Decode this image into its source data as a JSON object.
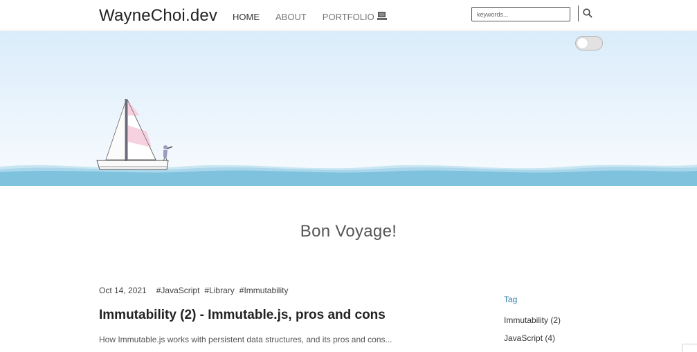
{
  "header": {
    "logo": "WayneChoi.dev",
    "nav": [
      {
        "label": "HOME",
        "active": true
      },
      {
        "label": "ABOUT",
        "active": false
      },
      {
        "label": "PORTFOLIO",
        "active": false
      }
    ],
    "nav_icon": "computer-icon",
    "search": {
      "placeholder": "keywords...",
      "value": ""
    },
    "search_icon": "search-icon"
  },
  "hero": {
    "theme_toggle": {
      "state": "off"
    },
    "colors": {
      "sky_top": "#daecfa",
      "sea": "#7ec2de",
      "sail_pink": "#f6d2e0"
    }
  },
  "page_title": "Bon Voyage!",
  "post": {
    "date": "Oct 14, 2021",
    "tags": [
      "#JavaScript",
      "#Library",
      "#Immutability"
    ],
    "title": "Immutability (2) - Immutable.js, pros and cons",
    "description": "How Immutable.js works with persistent data structures, and its pros and cons..."
  },
  "sidebar": {
    "heading": "Tag",
    "items": [
      {
        "label": "Immutability (2)"
      },
      {
        "label": "JavaScript (4)"
      }
    ]
  }
}
